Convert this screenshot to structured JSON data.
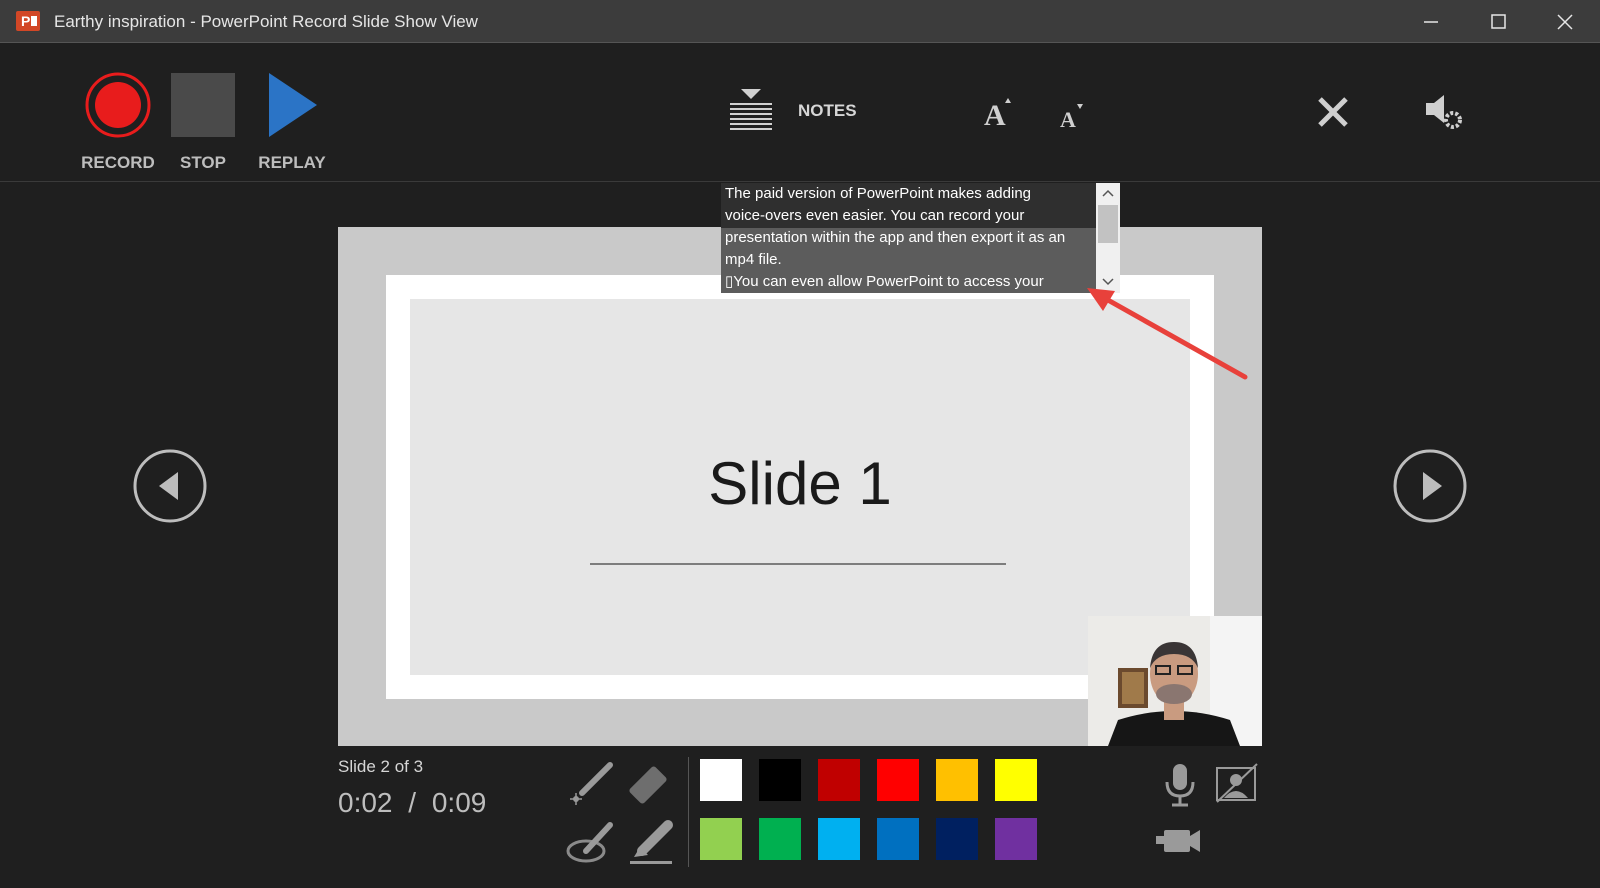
{
  "window": {
    "title": "Earthy inspiration  -  PowerPoint Record Slide Show View",
    "app_icon": "powerpoint-icon",
    "controls": [
      "minimize-icon",
      "maximize-icon",
      "close-icon"
    ]
  },
  "toolbar": {
    "record_label": "RECORD",
    "stop_label": "STOP",
    "replay_label": "REPLAY",
    "notes_label": "NOTES",
    "record_color": "#e81c1c",
    "replay_color": "#2b74c6"
  },
  "notes": {
    "text": "The paid version of PowerPoint makes adding\nvoice-overs even easier. You can record your\npresentation within the app and then export it as an\nmp4 file.\n▯You can even allow PowerPoint to access your"
  },
  "slide": {
    "title": "Slide 1"
  },
  "status": {
    "slide_counter": "Slide 2 of 3",
    "time_current": "0:02",
    "time_separator": "/",
    "time_total": "0:09"
  },
  "pen_colors": [
    "#ffffff",
    "#000000",
    "#c00000",
    "#ff0000",
    "#ffc000",
    "#ffff00",
    "#92d050",
    "#00b050",
    "#00b0f0",
    "#0070c0",
    "#002060",
    "#7030a0"
  ],
  "accent_arrow_color": "#e8413b"
}
